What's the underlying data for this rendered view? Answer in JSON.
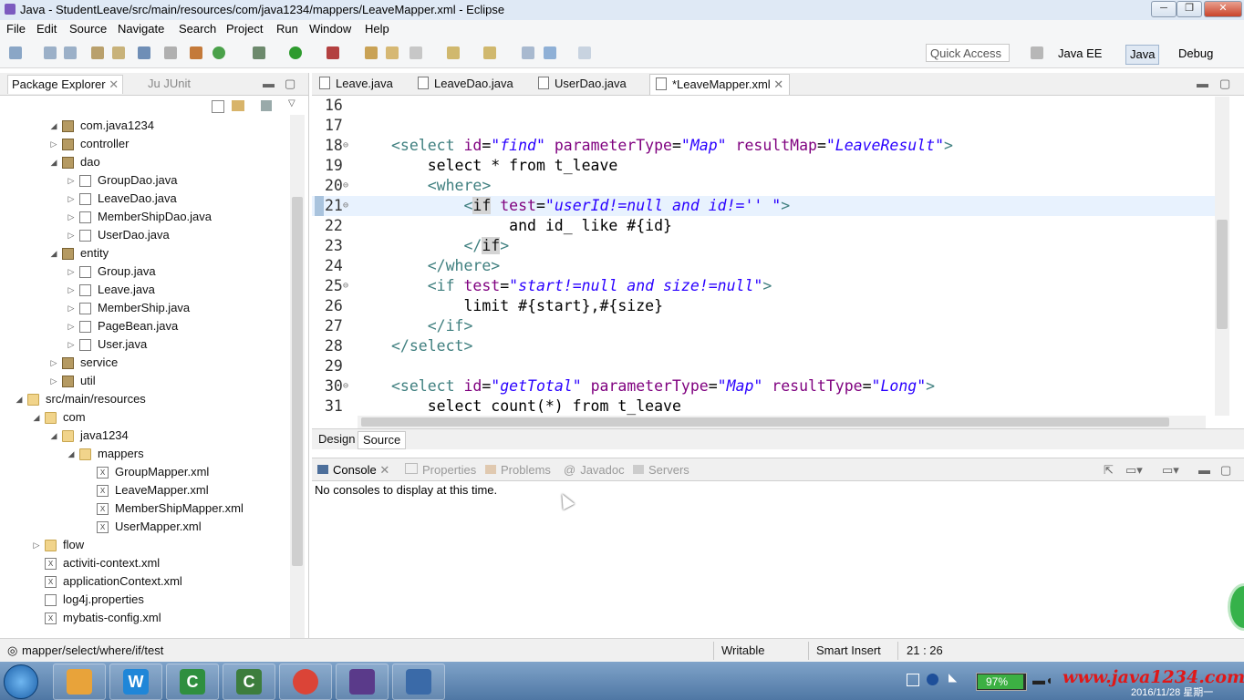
{
  "window": {
    "title": "Java - StudentLeave/src/main/resources/com/java1234/mappers/LeaveMapper.xml - Eclipse"
  },
  "menu": [
    "File",
    "Edit",
    "Source",
    "Navigate",
    "Search",
    "Project",
    "Run",
    "Window",
    "Help"
  ],
  "toolbar": {
    "quick_access": "Quick Access",
    "perspectives": [
      "Java EE",
      "Java",
      "Debug"
    ]
  },
  "left_view": {
    "tabs": [
      "Package Explorer",
      "JUnit"
    ],
    "tree": [
      {
        "label": "com.java1234",
        "icon": "package-icon",
        "arrow": "expanded"
      },
      {
        "label": "controller",
        "icon": "package-icon",
        "arrow": "collapsed"
      },
      {
        "label": "dao",
        "icon": "package-icon",
        "arrow": "expanded"
      },
      {
        "label": "GroupDao.java",
        "icon": "java-file-icon",
        "arrow": "collapsed"
      },
      {
        "label": "LeaveDao.java",
        "icon": "java-file-icon",
        "arrow": "collapsed"
      },
      {
        "label": "MemberShipDao.java",
        "icon": "java-file-icon",
        "arrow": "collapsed"
      },
      {
        "label": "UserDao.java",
        "icon": "java-file-icon",
        "arrow": "collapsed"
      },
      {
        "label": "entity",
        "icon": "package-icon",
        "arrow": "expanded"
      },
      {
        "label": "Group.java",
        "icon": "java-file-icon",
        "arrow": "collapsed"
      },
      {
        "label": "Leave.java",
        "icon": "java-file-icon",
        "arrow": "collapsed"
      },
      {
        "label": "MemberShip.java",
        "icon": "java-file-icon",
        "arrow": "collapsed"
      },
      {
        "label": "PageBean.java",
        "icon": "java-file-icon",
        "arrow": "collapsed"
      },
      {
        "label": "User.java",
        "icon": "java-file-icon",
        "arrow": "collapsed"
      },
      {
        "label": "service",
        "icon": "package-icon",
        "arrow": "collapsed"
      },
      {
        "label": "util",
        "icon": "package-icon",
        "arrow": "collapsed"
      },
      {
        "label": "src/main/resources",
        "icon": "source-folder-icon",
        "arrow": "expanded"
      },
      {
        "label": "com",
        "icon": "folder-icon",
        "arrow": "expanded"
      },
      {
        "label": "java1234",
        "icon": "folder-icon",
        "arrow": "expanded"
      },
      {
        "label": "mappers",
        "icon": "folder-icon",
        "arrow": "expanded"
      },
      {
        "label": "GroupMapper.xml",
        "icon": "xml-file-icon",
        "arrow": ""
      },
      {
        "label": "LeaveMapper.xml",
        "icon": "xml-file-icon",
        "arrow": ""
      },
      {
        "label": "MemberShipMapper.xml",
        "icon": "xml-file-icon",
        "arrow": ""
      },
      {
        "label": "UserMapper.xml",
        "icon": "xml-file-icon",
        "arrow": ""
      },
      {
        "label": "flow",
        "icon": "folder-icon",
        "arrow": "collapsed"
      },
      {
        "label": "activiti-context.xml",
        "icon": "xml-file-icon",
        "arrow": ""
      },
      {
        "label": "applicationContext.xml",
        "icon": "xml-file-icon",
        "arrow": ""
      },
      {
        "label": "log4j.properties",
        "icon": "properties-file-icon",
        "arrow": ""
      },
      {
        "label": "mybatis-config.xml",
        "icon": "xml-file-icon",
        "arrow": ""
      }
    ]
  },
  "editor": {
    "tabs": [
      "Leave.java",
      "LeaveDao.java",
      "UserDao.java",
      "*LeaveMapper.xml"
    ],
    "lines": [
      {
        "n": "16",
        "fold": "",
        "parts": []
      },
      {
        "n": "17",
        "fold": "",
        "parts": []
      },
      {
        "n": "18",
        "fold": "⊖",
        "parts": [
          [
            "tg",
            "<select "
          ],
          [
            "an",
            "id"
          ],
          [
            "tx",
            "="
          ],
          [
            "av",
            "\"find\""
          ],
          [
            "tx",
            " "
          ],
          [
            "an",
            "parameterType"
          ],
          [
            "tx",
            "="
          ],
          [
            "av",
            "\"Map\""
          ],
          [
            "tx",
            " "
          ],
          [
            "an",
            "resultMap"
          ],
          [
            "tx",
            "="
          ],
          [
            "av",
            "\"LeaveResult\""
          ],
          [
            "tg",
            ">"
          ]
        ]
      },
      {
        "n": "19",
        "fold": "",
        "parts": [
          [
            "tx",
            "    select * from t_leave"
          ]
        ]
      },
      {
        "n": "20",
        "fold": "⊖",
        "parts": [
          [
            "tg",
            "    <where>"
          ]
        ]
      },
      {
        "n": "21",
        "fold": "⊖",
        "parts": [
          [
            "tg",
            "        <"
          ],
          [
            "hl",
            "if"
          ],
          [
            "tx",
            " "
          ],
          [
            "an",
            "test"
          ],
          [
            "tx",
            "="
          ],
          [
            "av",
            "\"userId!=null and id!='' \""
          ],
          [
            "tg",
            ">"
          ]
        ]
      },
      {
        "n": "22",
        "fold": "",
        "parts": [
          [
            "tx",
            "             and id_ like #{id}"
          ]
        ]
      },
      {
        "n": "23",
        "fold": "",
        "parts": [
          [
            "tg",
            "        </"
          ],
          [
            "hl",
            "if"
          ],
          [
            "tg",
            ">"
          ]
        ]
      },
      {
        "n": "24",
        "fold": "",
        "parts": [
          [
            "tg",
            "    </where>"
          ]
        ]
      },
      {
        "n": "25",
        "fold": "⊖",
        "parts": [
          [
            "tg",
            "    <if "
          ],
          [
            "an",
            "test"
          ],
          [
            "tx",
            "="
          ],
          [
            "av",
            "\"start!=null and size!=null\""
          ],
          [
            "tg",
            ">"
          ]
        ]
      },
      {
        "n": "26",
        "fold": "",
        "parts": [
          [
            "tx",
            "        limit #{start},#{size}"
          ]
        ]
      },
      {
        "n": "27",
        "fold": "",
        "parts": [
          [
            "tg",
            "    </if>"
          ]
        ]
      },
      {
        "n": "28",
        "fold": "",
        "parts": [
          [
            "tg",
            "</select>"
          ]
        ]
      },
      {
        "n": "29",
        "fold": "",
        "parts": []
      },
      {
        "n": "30",
        "fold": "⊖",
        "parts": [
          [
            "tg",
            "<select "
          ],
          [
            "an",
            "id"
          ],
          [
            "tx",
            "="
          ],
          [
            "av",
            "\"getTotal\""
          ],
          [
            "tx",
            " "
          ],
          [
            "an",
            "parameterType"
          ],
          [
            "tx",
            "="
          ],
          [
            "av",
            "\"Map\""
          ],
          [
            "tx",
            " "
          ],
          [
            "an",
            "resultType"
          ],
          [
            "tx",
            "="
          ],
          [
            "av",
            "\"Long\""
          ],
          [
            "tg",
            ">"
          ]
        ]
      },
      {
        "n": "31",
        "fold": "",
        "parts": [
          [
            "tx",
            "    select count(*) from t_leave"
          ]
        ]
      }
    ],
    "bottom_tabs": [
      "Design",
      "Source"
    ]
  },
  "console": {
    "tabs": [
      "Console",
      "Properties",
      "Problems",
      "Javadoc",
      "Servers"
    ],
    "message": "No consoles to display at this time."
  },
  "status": {
    "path": "mapper/select/where/if/test",
    "writable": "Writable",
    "insert_mode": "Smart Insert",
    "position": "21 : 26"
  },
  "taskbar": {
    "battery": "97%",
    "battery_level": 0.97,
    "watermark": "www.java1234.com",
    "date": "2016/11/28 星期一"
  },
  "colors": {
    "tag": "#3f7f7f",
    "attr_name": "#7f007f",
    "attr_value": "#2a00ff",
    "current_line": "#e8f2fe"
  }
}
